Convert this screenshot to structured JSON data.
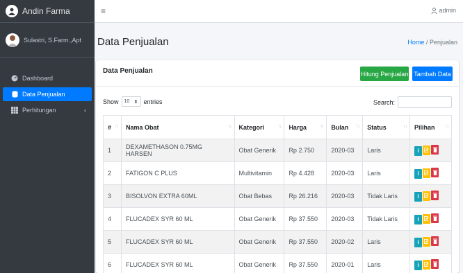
{
  "brand": {
    "name": "Andin Farma"
  },
  "user": {
    "name": "Sulastri, S.Farm.,Apt"
  },
  "nav": [
    {
      "label": "Dashboard",
      "icon": "dashboard-icon",
      "active": false
    },
    {
      "label": "Data Penjualan",
      "icon": "database-icon",
      "active": true
    },
    {
      "label": "Perhitungan",
      "icon": "grid-icon",
      "active": false
    }
  ],
  "topbar": {
    "menu_icon": "hamburger-icon",
    "admin_label": "admin"
  },
  "page": {
    "title": "Data Penjualan",
    "breadcrumb_home": "Home",
    "breadcrumb_sep": "/",
    "breadcrumb_current": "Penjualan"
  },
  "card": {
    "title": "Data Penjualan",
    "btn_hitung": "Hitung Penjualan",
    "btn_tambah": "Tambah Data",
    "show_label": "Show",
    "entries_value": "10",
    "entries_label": "entries",
    "search_label": "Search:"
  },
  "table": {
    "columns": [
      "#",
      "Nama Obat",
      "Kategori",
      "Harga",
      "Bulan",
      "Status",
      "Pilihan"
    ],
    "rows": [
      [
        "1",
        "DEXAMETHASON 0.75MG HARSEN",
        "Obat Generik",
        "Rp 2.750",
        "2020-03",
        "Laris"
      ],
      [
        "2",
        "FATIGON C PLUS",
        "Multivitamin",
        "Rp 4.428",
        "2020-03",
        "Laris"
      ],
      [
        "3",
        "BISOLVON EXTRA 60ML",
        "Obat Bebas",
        "Rp 26.216",
        "2020-03",
        "Tidak Laris"
      ],
      [
        "4",
        "FLUCADEX SYR 60 ML",
        "Obat Generik",
        "Rp 37.550",
        "2020-03",
        "Tidak Laris"
      ],
      [
        "5",
        "FLUCADEX SYR 60 ML",
        "Obat Generik",
        "Rp 37.550",
        "2020-02",
        "Laris"
      ],
      [
        "6",
        "FLUCADEX SYR 60 ML",
        "Obat Generik",
        "Rp 37.550",
        "2020-01",
        "Laris"
      ]
    ],
    "action_info": "i"
  },
  "colors": {
    "primary": "#007bff",
    "success": "#28a745",
    "info": "#17a2b8",
    "warning": "#ffc107",
    "danger": "#dc3545",
    "sidebar": "#343a40"
  }
}
